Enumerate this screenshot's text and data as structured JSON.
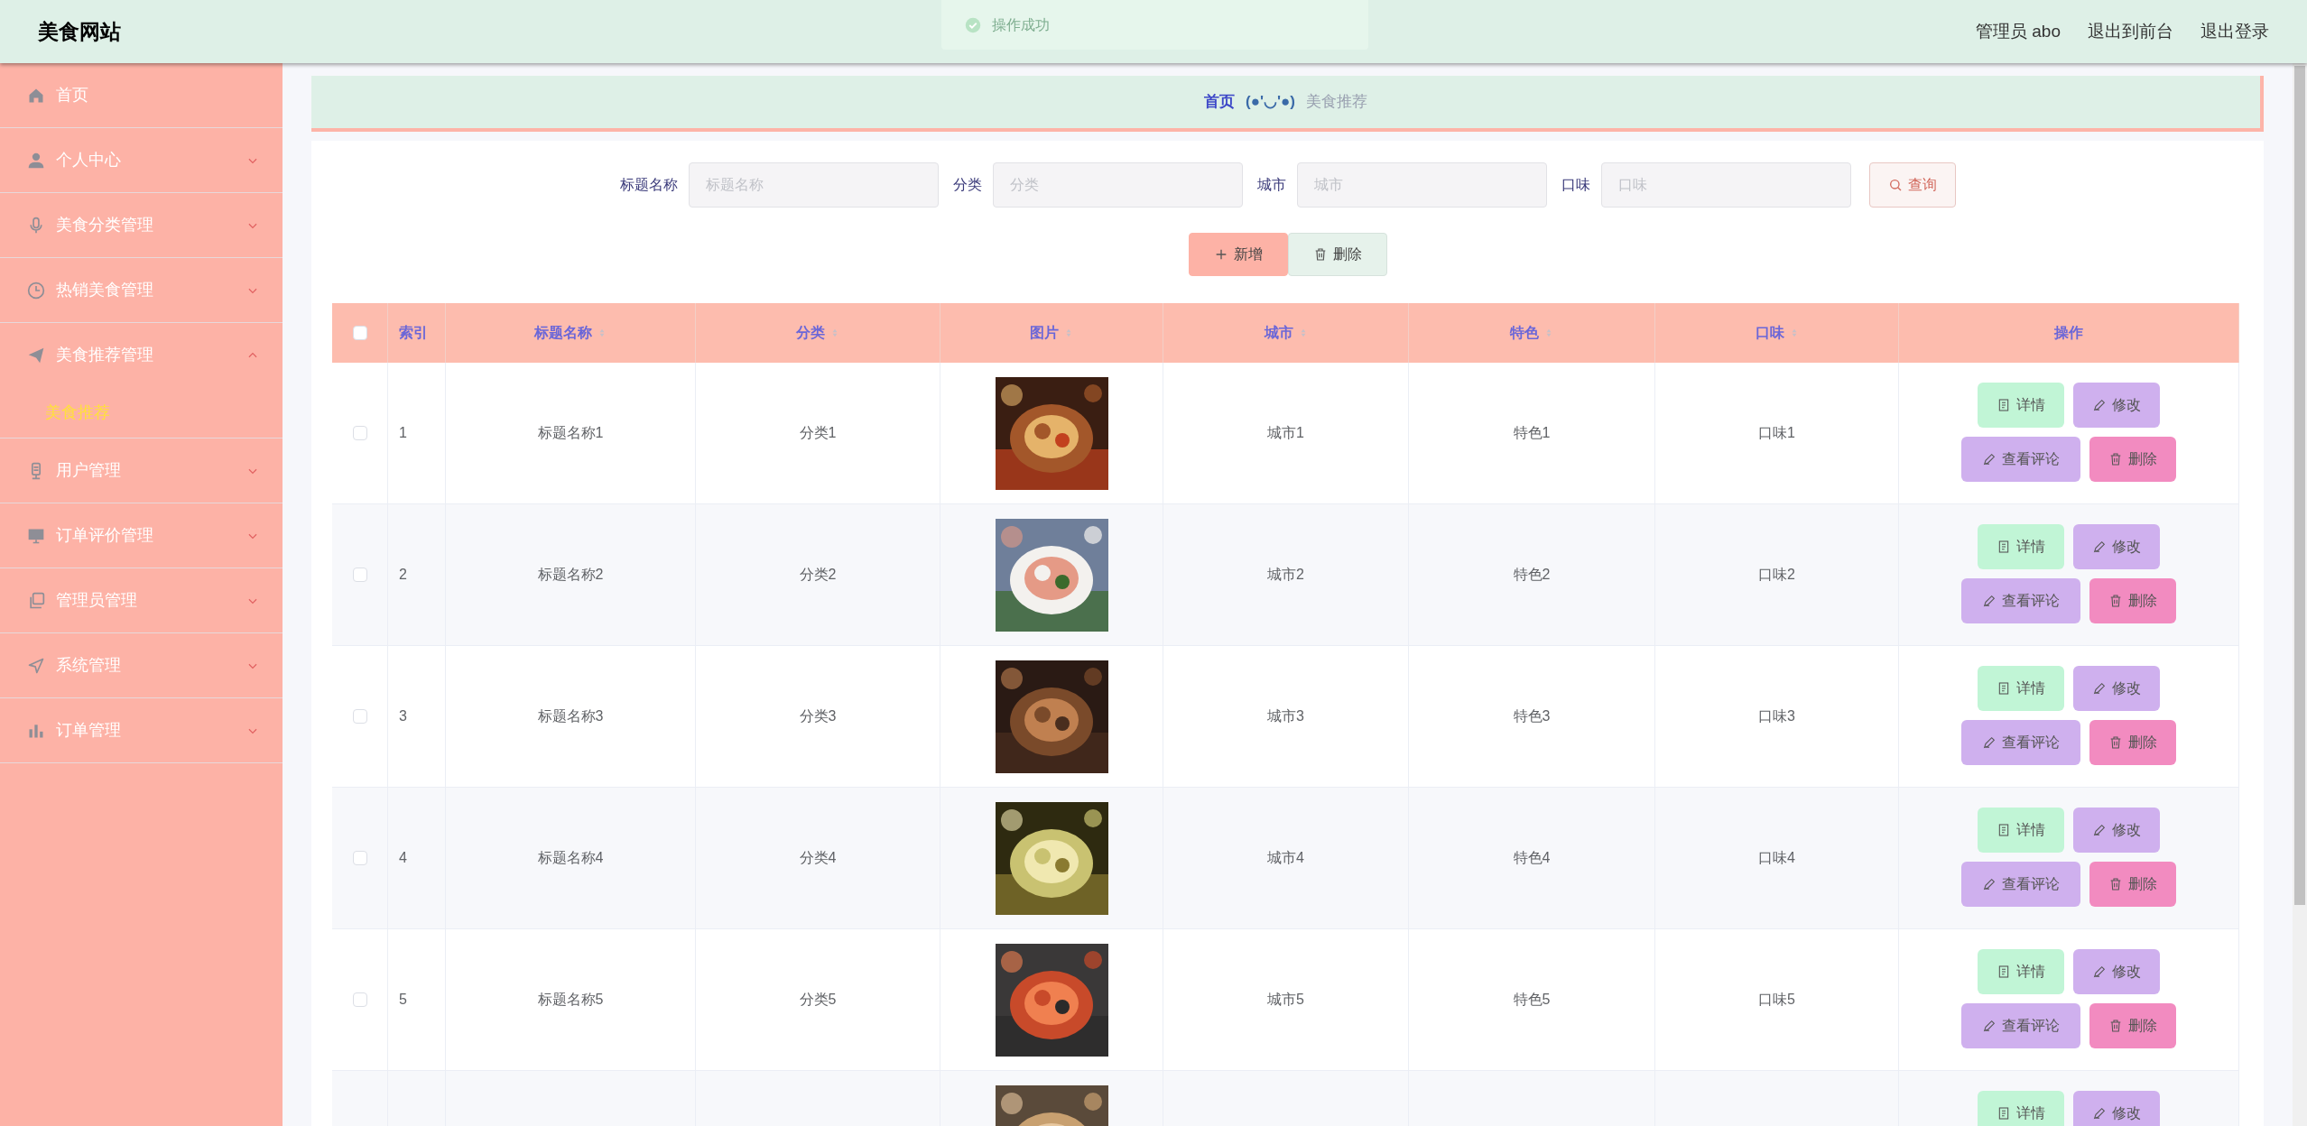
{
  "header": {
    "title": "美食网站",
    "user": "管理员 abo",
    "links": [
      "退出到前台",
      "退出登录"
    ]
  },
  "toast": {
    "text": "操作成功"
  },
  "sidebar": {
    "items": [
      {
        "label": "首页",
        "kind": "link"
      },
      {
        "label": "个人中心",
        "kind": "group",
        "expanded": false
      },
      {
        "label": "美食分类管理",
        "kind": "group",
        "expanded": false
      },
      {
        "label": "热销美食管理",
        "kind": "group",
        "expanded": false
      },
      {
        "label": "美食推荐管理",
        "kind": "group",
        "expanded": true,
        "children": [
          {
            "label": "美食推荐",
            "selected": true
          }
        ]
      },
      {
        "label": "用户管理",
        "kind": "group",
        "expanded": false
      },
      {
        "label": "订单评价管理",
        "kind": "group",
        "expanded": false
      },
      {
        "label": "管理员管理",
        "kind": "group",
        "expanded": false
      },
      {
        "label": "系统管理",
        "kind": "group",
        "expanded": false
      },
      {
        "label": "订单管理",
        "kind": "group",
        "expanded": false
      }
    ]
  },
  "breadcrumb": {
    "home": "首页",
    "separator": "(●'◡'●)",
    "current": "美食推荐"
  },
  "search": {
    "fields": [
      {
        "label": "标题名称",
        "placeholder": "标题名称"
      },
      {
        "label": "分类",
        "placeholder": "分类"
      },
      {
        "label": "城市",
        "placeholder": "城市"
      },
      {
        "label": "口味",
        "placeholder": "口味"
      }
    ],
    "button": "查询"
  },
  "toolbar": [
    {
      "label": "新增",
      "kind": "add"
    },
    {
      "label": "删除",
      "kind": "delete"
    }
  ],
  "table": {
    "select_all": {
      "checked": false
    },
    "columns": [
      {
        "label": "索引",
        "sortable": false
      },
      {
        "label": "标题名称",
        "sortable": true
      },
      {
        "label": "分类",
        "sortable": true
      },
      {
        "label": "图片",
        "sortable": true
      },
      {
        "label": "城市",
        "sortable": true
      },
      {
        "label": "特色",
        "sortable": true
      },
      {
        "label": "口味",
        "sortable": true
      },
      {
        "label": "操作",
        "sortable": false
      }
    ],
    "rows": [
      {
        "checked": false,
        "index": "1",
        "title": "标题名称1",
        "category": "分类1",
        "city": "城市1",
        "feature": "特色1",
        "taste": "口味1",
        "actions": [
          {
            "label": "详情",
            "kind": "detail"
          },
          {
            "label": "修改",
            "kind": "edit"
          },
          {
            "label": "查看评论",
            "kind": "comments"
          },
          {
            "label": "删除",
            "kind": "delete"
          }
        ]
      },
      {
        "checked": false,
        "index": "2",
        "title": "标题名称2",
        "category": "分类2",
        "city": "城市2",
        "feature": "特色2",
        "taste": "口味2",
        "actions": [
          {
            "label": "详情",
            "kind": "detail"
          },
          {
            "label": "修改",
            "kind": "edit"
          },
          {
            "label": "查看评论",
            "kind": "comments"
          },
          {
            "label": "删除",
            "kind": "delete"
          }
        ]
      },
      {
        "checked": false,
        "index": "3",
        "title": "标题名称3",
        "category": "分类3",
        "city": "城市3",
        "feature": "特色3",
        "taste": "口味3",
        "actions": [
          {
            "label": "详情",
            "kind": "detail"
          },
          {
            "label": "修改",
            "kind": "edit"
          },
          {
            "label": "查看评论",
            "kind": "comments"
          },
          {
            "label": "删除",
            "kind": "delete"
          }
        ]
      },
      {
        "checked": false,
        "index": "4",
        "title": "标题名称4",
        "category": "分类4",
        "city": "城市4",
        "feature": "特色4",
        "taste": "口味4",
        "actions": [
          {
            "label": "详情",
            "kind": "detail"
          },
          {
            "label": "修改",
            "kind": "edit"
          },
          {
            "label": "查看评论",
            "kind": "comments"
          },
          {
            "label": "删除",
            "kind": "delete"
          }
        ]
      },
      {
        "checked": false,
        "index": "5",
        "title": "标题名称5",
        "category": "分类5",
        "city": "城市5",
        "feature": "特色5",
        "taste": "口味5",
        "actions": [
          {
            "label": "详情",
            "kind": "detail"
          },
          {
            "label": "修改",
            "kind": "edit"
          },
          {
            "label": "查看评论",
            "kind": "comments"
          },
          {
            "label": "删除",
            "kind": "delete"
          }
        ]
      },
      {
        "actions": [
          {
            "label": "详情",
            "kind": "detail"
          },
          {
            "label": "修改",
            "kind": "edit"
          }
        ]
      }
    ]
  }
}
